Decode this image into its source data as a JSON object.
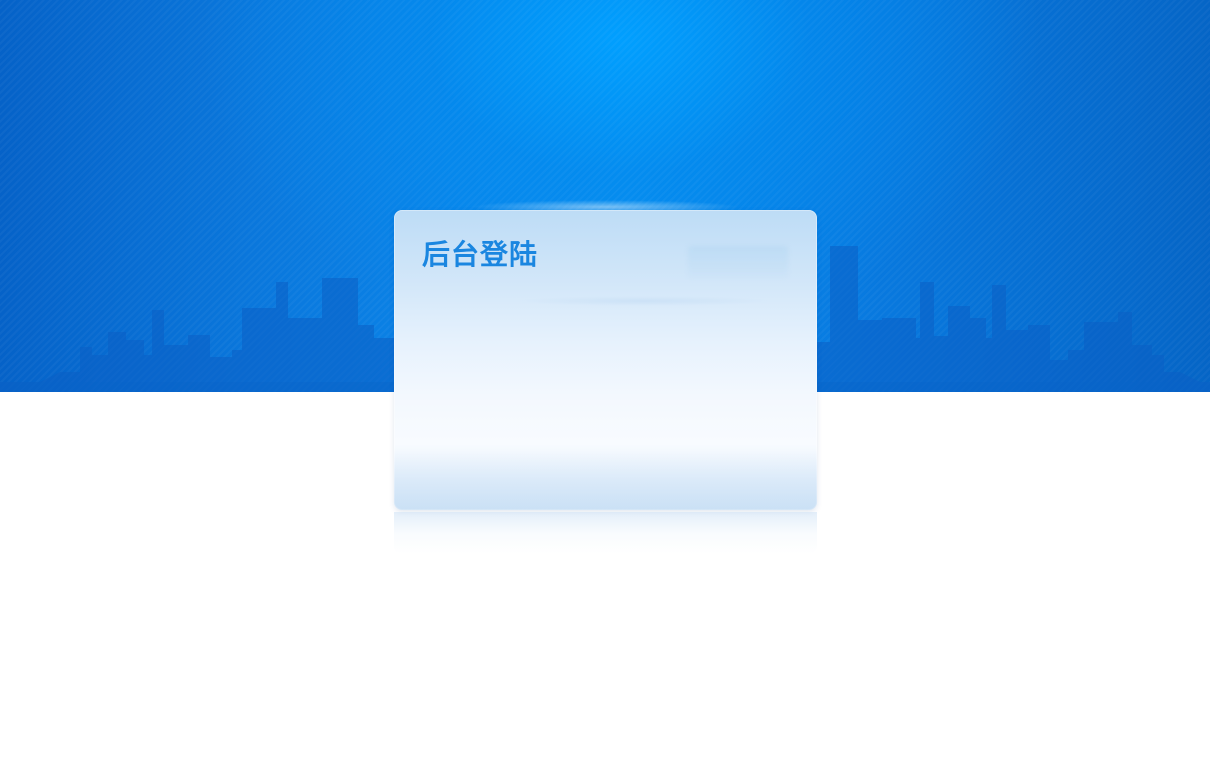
{
  "login": {
    "title": "后台登陆"
  },
  "colors": {
    "banner_blue": "#0a7fe4",
    "banner_dark_blue": "#0565c6",
    "title_blue": "#1a86e0",
    "card_top": "#bddcf6",
    "card_bottom": "#f8fbff",
    "page_background": "#ffffff"
  }
}
